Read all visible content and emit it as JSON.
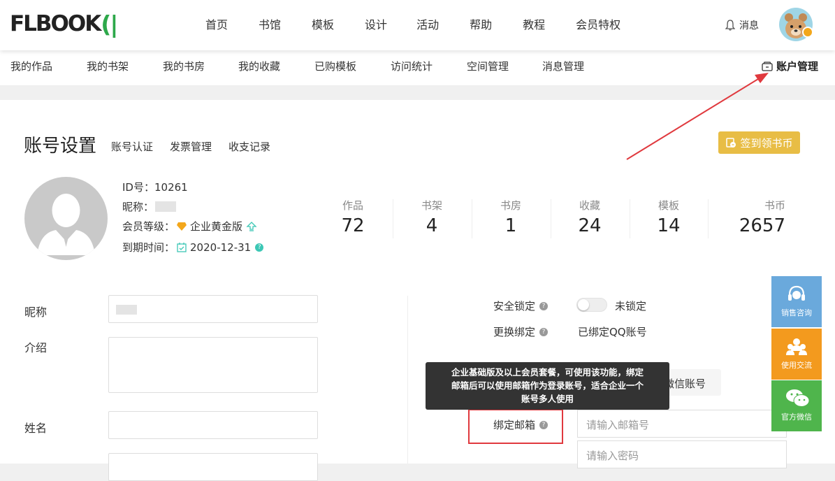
{
  "header": {
    "logo_text": "FLBOOK",
    "nav": [
      "首页",
      "书馆",
      "模板",
      "设计",
      "活动",
      "帮助",
      "教程",
      "会员特权"
    ],
    "messages_label": "消息"
  },
  "subnav": {
    "items": [
      "我的作品",
      "我的书架",
      "我的书房",
      "我的收藏",
      "已购模板",
      "访问统计",
      "空间管理",
      "消息管理"
    ],
    "account_label": "账户管理"
  },
  "page": {
    "title": "账号设置",
    "tabs": [
      "账号认证",
      "发票管理",
      "收支记录"
    ],
    "checkin_label": "签到领书币"
  },
  "profile": {
    "id_label": "ID号：",
    "id_value": "10261",
    "nickname_label": "昵称：",
    "level_label": "会员等级：",
    "level_value": "企业黄金版",
    "expiry_label": "到期时间：",
    "expiry_value": "2020-12-31"
  },
  "stats": [
    {
      "label": "作品",
      "value": "72"
    },
    {
      "label": "书架",
      "value": "4"
    },
    {
      "label": "书房",
      "value": "1"
    },
    {
      "label": "收藏",
      "value": "24"
    },
    {
      "label": "模板",
      "value": "14"
    },
    {
      "label": "书币",
      "value": "2657"
    }
  ],
  "form_left": {
    "nickname_label": "昵称",
    "intro_label": "介绍",
    "name_label": "姓名"
  },
  "form_right": {
    "lock_label": "安全锁定",
    "lock_state": "未锁定",
    "rebind_label": "更换绑定",
    "rebind_value": "已绑定QQ账号",
    "wechat_button": "微信账号",
    "email_label": "绑定邮箱",
    "email_placeholder": "请输入邮箱号",
    "password_placeholder": "请输入密码"
  },
  "tooltip": {
    "line1": "企业基础版及以上会员套餐，可使用该功能，绑定",
    "line2": "邮箱后可以使用邮箱作为登录账号，适合企业一个",
    "line3": "账号多人使用"
  },
  "side": {
    "sales": "销售咨询",
    "community": "使用交流",
    "wechat": "官方微信"
  },
  "colors": {
    "accent_gold": "#e8bd45",
    "sales_blue": "#4aa4e0",
    "community_orange": "#f39a1e",
    "wechat_green": "#4fb54c",
    "highlight_red": "#e0393e"
  }
}
